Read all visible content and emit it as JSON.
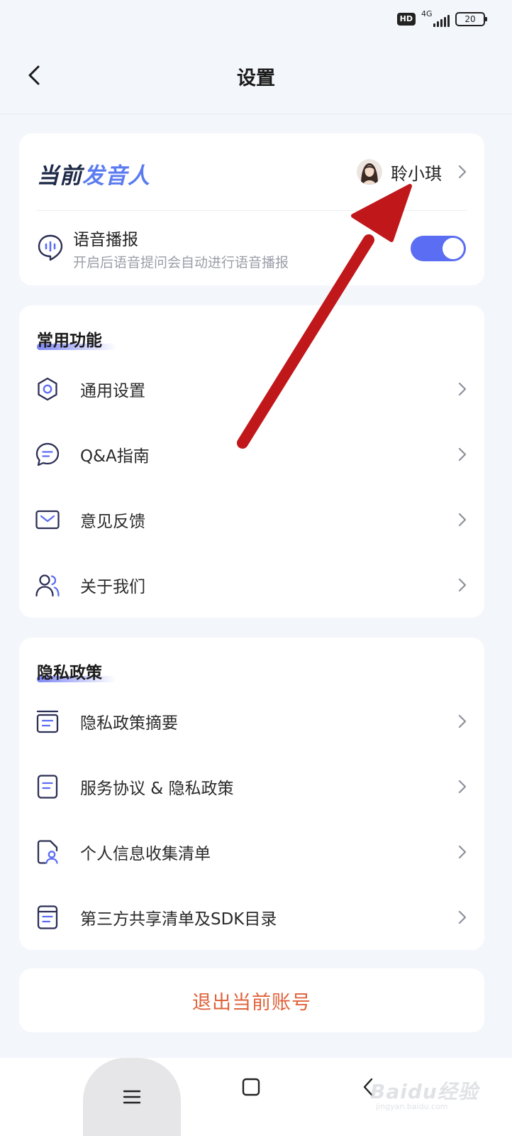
{
  "status_bar": {
    "hd": "HD",
    "network": "4G",
    "battery": "20"
  },
  "header": {
    "title": "设置"
  },
  "voice_card": {
    "title_part1": "当前",
    "title_part2": "发音人",
    "speaker_name": "聆小琪",
    "voice_label": "语音播报",
    "voice_desc": "开启后语音提问会自动进行语音播报",
    "voice_enabled": true
  },
  "common": {
    "title": "常用功能",
    "items": [
      {
        "label": "通用设置",
        "icon": "gear-icon"
      },
      {
        "label": "Q&A指南",
        "icon": "chat-bubble-icon"
      },
      {
        "label": "意见反馈",
        "icon": "mail-icon"
      },
      {
        "label": "关于我们",
        "icon": "users-icon"
      }
    ]
  },
  "privacy": {
    "title": "隐私政策",
    "items": [
      {
        "label": "隐私政策摘要",
        "icon": "archive-doc-icon"
      },
      {
        "label": "服务协议 & 隐私政策",
        "icon": "document-icon"
      },
      {
        "label": "个人信息收集清单",
        "icon": "user-document-icon"
      },
      {
        "label": "第三方共享清单及SDK目录",
        "icon": "folder-doc-icon"
      }
    ]
  },
  "logout": {
    "label": "退出当前账号"
  },
  "watermark": {
    "brand": "Baidu经验",
    "url": "jingyan.baidu.com"
  },
  "colors": {
    "accent": "#5b6df2",
    "logout": "#e0623a",
    "annotation_arrow": "#c0171b"
  }
}
